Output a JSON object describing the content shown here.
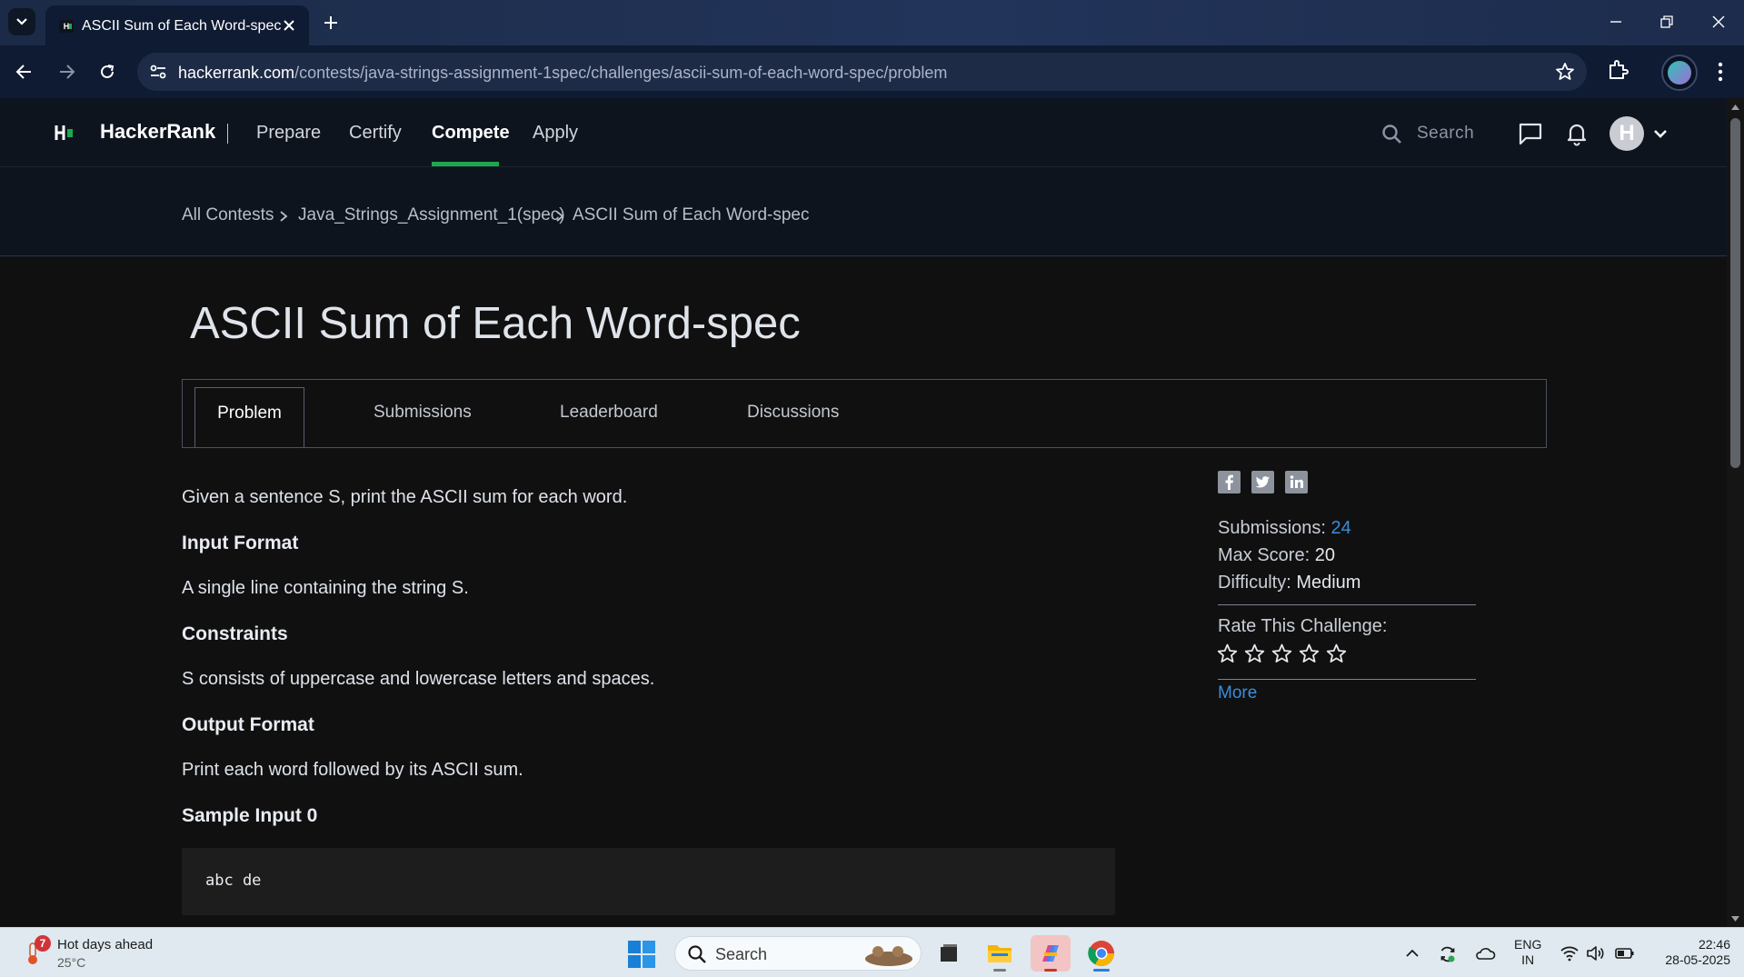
{
  "browser": {
    "tab_title": "ASCII Sum of Each Word-spec |",
    "url_host": "hackerrank.com",
    "url_path": "/contests/java-strings-assignment-1spec/challenges/ascii-sum-of-each-word-spec/problem"
  },
  "header": {
    "brand": "HackerRank",
    "nav": [
      "Prepare",
      "Certify",
      "Compete",
      "Apply"
    ],
    "active_nav": "Compete",
    "search_placeholder": "Search",
    "avatar_initial": "H"
  },
  "breadcrumb": [
    "All Contests",
    "Java_Strings_Assignment_1(spec)",
    "ASCII Sum of Each Word-spec"
  ],
  "challenge": {
    "title": "ASCII Sum of Each Word-spec",
    "tabs": [
      "Problem",
      "Submissions",
      "Leaderboard",
      "Discussions"
    ],
    "active_tab": "Problem",
    "description": "Given a sentence S, print the ASCII sum for each word.",
    "input_format_heading": "Input Format",
    "input_format": "A single line containing the string S.",
    "constraints_heading": "Constraints",
    "constraints": "S consists of uppercase and lowercase letters and spaces.",
    "output_format_heading": "Output Format",
    "output_format": "Print each word followed by its ASCII sum.",
    "sample_input_heading": "Sample Input 0",
    "sample_input": "abc de"
  },
  "sidebar": {
    "submissions_label": "Submissions:",
    "submissions_value": "24",
    "max_score_label": "Max Score:",
    "max_score_value": "20",
    "difficulty_label": "Difficulty:",
    "difficulty_value": "Medium",
    "rate_label": "Rate This Challenge:",
    "rating": 0,
    "rating_max": 5,
    "more_label": "More"
  },
  "taskbar": {
    "weather_title": "Hot days ahead",
    "weather_temp": "25°C",
    "weather_badge": "7",
    "search_label": "Search",
    "lang_line1": "ENG",
    "lang_line2": "IN",
    "time": "22:46",
    "date": "28-05-2025"
  },
  "colors": {
    "accent_green": "#1ba94c",
    "link_blue": "#3b8dd9",
    "page_bg": "#101010",
    "header_bg": "#0e141e"
  }
}
